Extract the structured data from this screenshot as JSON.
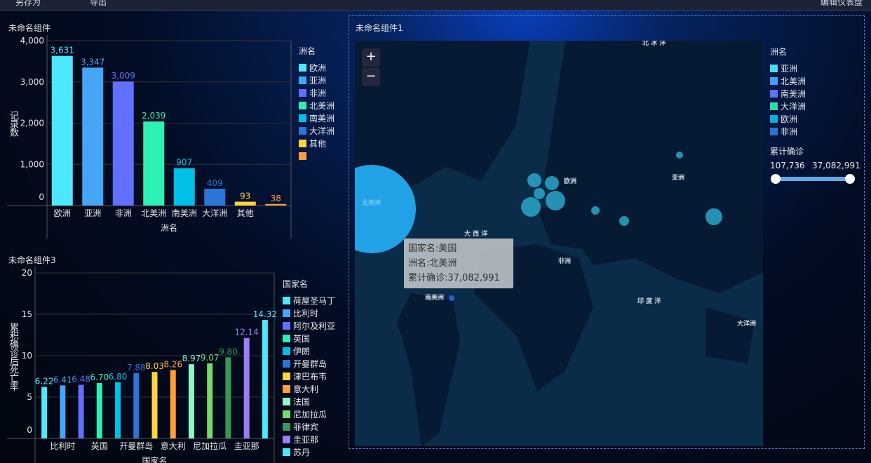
{
  "toolbar": {
    "save_as": "另存为",
    "export": "导出",
    "edit": "编辑仪表盘"
  },
  "panel1": {
    "title": "未命名组件"
  },
  "panel3": {
    "title": "未命名组件3"
  },
  "map_panel": {
    "title": "未命名组件1",
    "zoom_in": "+",
    "zoom_out": "−",
    "labels": {
      "arctic": "北 冰 洋",
      "atlantic": "大 西 洋",
      "europe": "欧洲",
      "asia": "亚洲",
      "north_america": "北美洲",
      "south_america": "南美洲",
      "africa": "非洲",
      "indian": "印 度 洋",
      "oceania": "大洋洲"
    },
    "tooltip": {
      "country": "国家名:美国",
      "continent": "洲名:北美洲",
      "cases": "累计确诊:37,082,991"
    },
    "legend": {
      "title": "洲名",
      "items": [
        {
          "label": "亚洲",
          "color": "#4dd9ff"
        },
        {
          "label": "北美洲",
          "color": "#3fa0f5"
        },
        {
          "label": "南美洲",
          "color": "#6070ff"
        },
        {
          "label": "大洋洲",
          "color": "#2ddba6"
        },
        {
          "label": "欧洲",
          "color": "#00b3dc"
        },
        {
          "label": "非洲",
          "color": "#2b73d6"
        }
      ]
    },
    "range": {
      "title": "累计确诊",
      "min": "107,736",
      "max": "37,082,991"
    }
  },
  "chart_data": [
    {
      "type": "bar",
      "title": "未命名组件",
      "xlabel": "洲名",
      "ylabel": "记录数",
      "ylim": [
        0,
        4000
      ],
      "yticks": [
        "0",
        "1,000",
        "2,000",
        "3,000",
        "4,000"
      ],
      "legend_title": "洲名",
      "categories": [
        "欧洲",
        "亚洲",
        "非洲",
        "北美洲",
        "南美洲",
        "大洋洲",
        "其他",
        ""
      ],
      "values": [
        3631,
        3347,
        3009,
        2039,
        907,
        409,
        93,
        38
      ],
      "labels": [
        "3,631",
        "3,347",
        "3,009",
        "2,039",
        "907",
        "409",
        "93",
        "38"
      ],
      "colors": [
        "#4de8ff",
        "#44a6f5",
        "#6170ff",
        "#2cf0b4",
        "#00c0e8",
        "#2b74d8",
        "#ffd440",
        "#ff9f3a"
      ]
    },
    {
      "type": "bar",
      "title": "未命名组件3",
      "xlabel": "国家名",
      "ylabel": "累积确诊后死亡率",
      "ylim": [
        0,
        20
      ],
      "yticks": [
        "0",
        "5",
        "10",
        "15",
        "20"
      ],
      "legend_title": "国家名",
      "categories": [
        "荷屋圣马丁",
        "比利时",
        "阿尔及利亚",
        "英国",
        "伊朗",
        "开曼群岛",
        "津巴布韦",
        "意大利",
        "法国",
        "尼加拉瓜",
        "菲律宾",
        "圭亚那",
        "苏丹"
      ],
      "values": [
        6.22,
        6.41,
        6.48,
        6.7,
        6.8,
        7.88,
        8.03,
        8.26,
        8.97,
        9.07,
        9.8,
        12.14,
        14.32
      ],
      "labels": [
        "6.22",
        "6.41",
        "6.48",
        "6.70",
        "6.80",
        "7.88",
        "8.03",
        "8.26",
        "8.97",
        "9.07",
        "9.80",
        "12.14",
        "14.32"
      ],
      "colors": [
        "#4de8ff",
        "#44a6f5",
        "#6170ff",
        "#2cf0b4",
        "#00c0e8",
        "#2b74d8",
        "#ffd440",
        "#ff9f3a",
        "#8ff5c8",
        "#77d96a",
        "#36975a",
        "#9b7df5",
        "#4de8ff"
      ]
    }
  ]
}
